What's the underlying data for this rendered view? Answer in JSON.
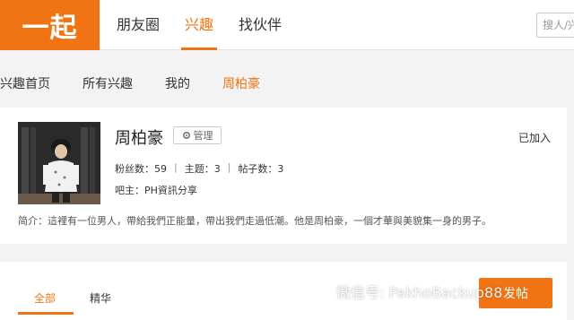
{
  "header": {
    "logo_text": "一起",
    "tabs": [
      {
        "label": "朋友圈"
      },
      {
        "label": "兴趣"
      },
      {
        "label": "找伙伴"
      }
    ],
    "search_placeholder": "搜人/兴"
  },
  "subnav": {
    "items": [
      {
        "label": "兴趣首页"
      },
      {
        "label": "所有兴趣"
      },
      {
        "label": "我的"
      },
      {
        "label": "周柏豪"
      }
    ]
  },
  "profile": {
    "name": "周柏豪",
    "manage_label": "管理",
    "joined_label": "已加入",
    "stats": {
      "fans": "粉丝数：59",
      "topics": "主题：3",
      "posts": "帖子数：3",
      "sep": "|"
    },
    "owner": "吧主：PH資訊分享",
    "intro": "简介：這裡有一位男人，帶給我們正能量，帶出我們走過低潮。他是周柏豪，一個才華與美貌集一身的男子。"
  },
  "posts": {
    "tabs": [
      {
        "label": "全部"
      },
      {
        "label": "精华"
      }
    ],
    "post_button": "发帖"
  },
  "watermark": "微信号: PakhoBackup88",
  "colors": {
    "accent": "#f07414",
    "background": "#f3f3f3"
  }
}
